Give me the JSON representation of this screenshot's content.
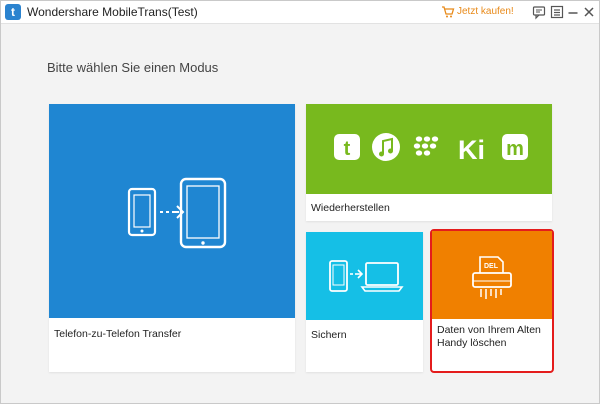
{
  "window": {
    "title": "Wondershare MobileTrans(Test)",
    "buy_label": "Jetzt kaufen!",
    "accent_color": "#2b83cf"
  },
  "icons": {
    "app_logo": "t",
    "toolbar": [
      "cart-icon",
      "feedback-icon",
      "menu-icon",
      "minimize-icon",
      "close-icon"
    ],
    "restore_brands": [
      "t",
      "music-note",
      "blackberry",
      "Ki",
      "m"
    ],
    "del_label": "DEL"
  },
  "main": {
    "prompt": "Bitte wählen Sie einen Modus",
    "tiles": {
      "phone_transfer": {
        "label": "Telefon-zu-Telefon Transfer",
        "color": "#1f86d2"
      },
      "restore": {
        "label": "Wiederherstellen",
        "color": "#78b91e"
      },
      "backup": {
        "label": "Sichern",
        "color": "#15bfe6"
      },
      "erase": {
        "label": "Daten von Ihrem Alten Handy löschen",
        "color": "#f08000"
      }
    }
  }
}
